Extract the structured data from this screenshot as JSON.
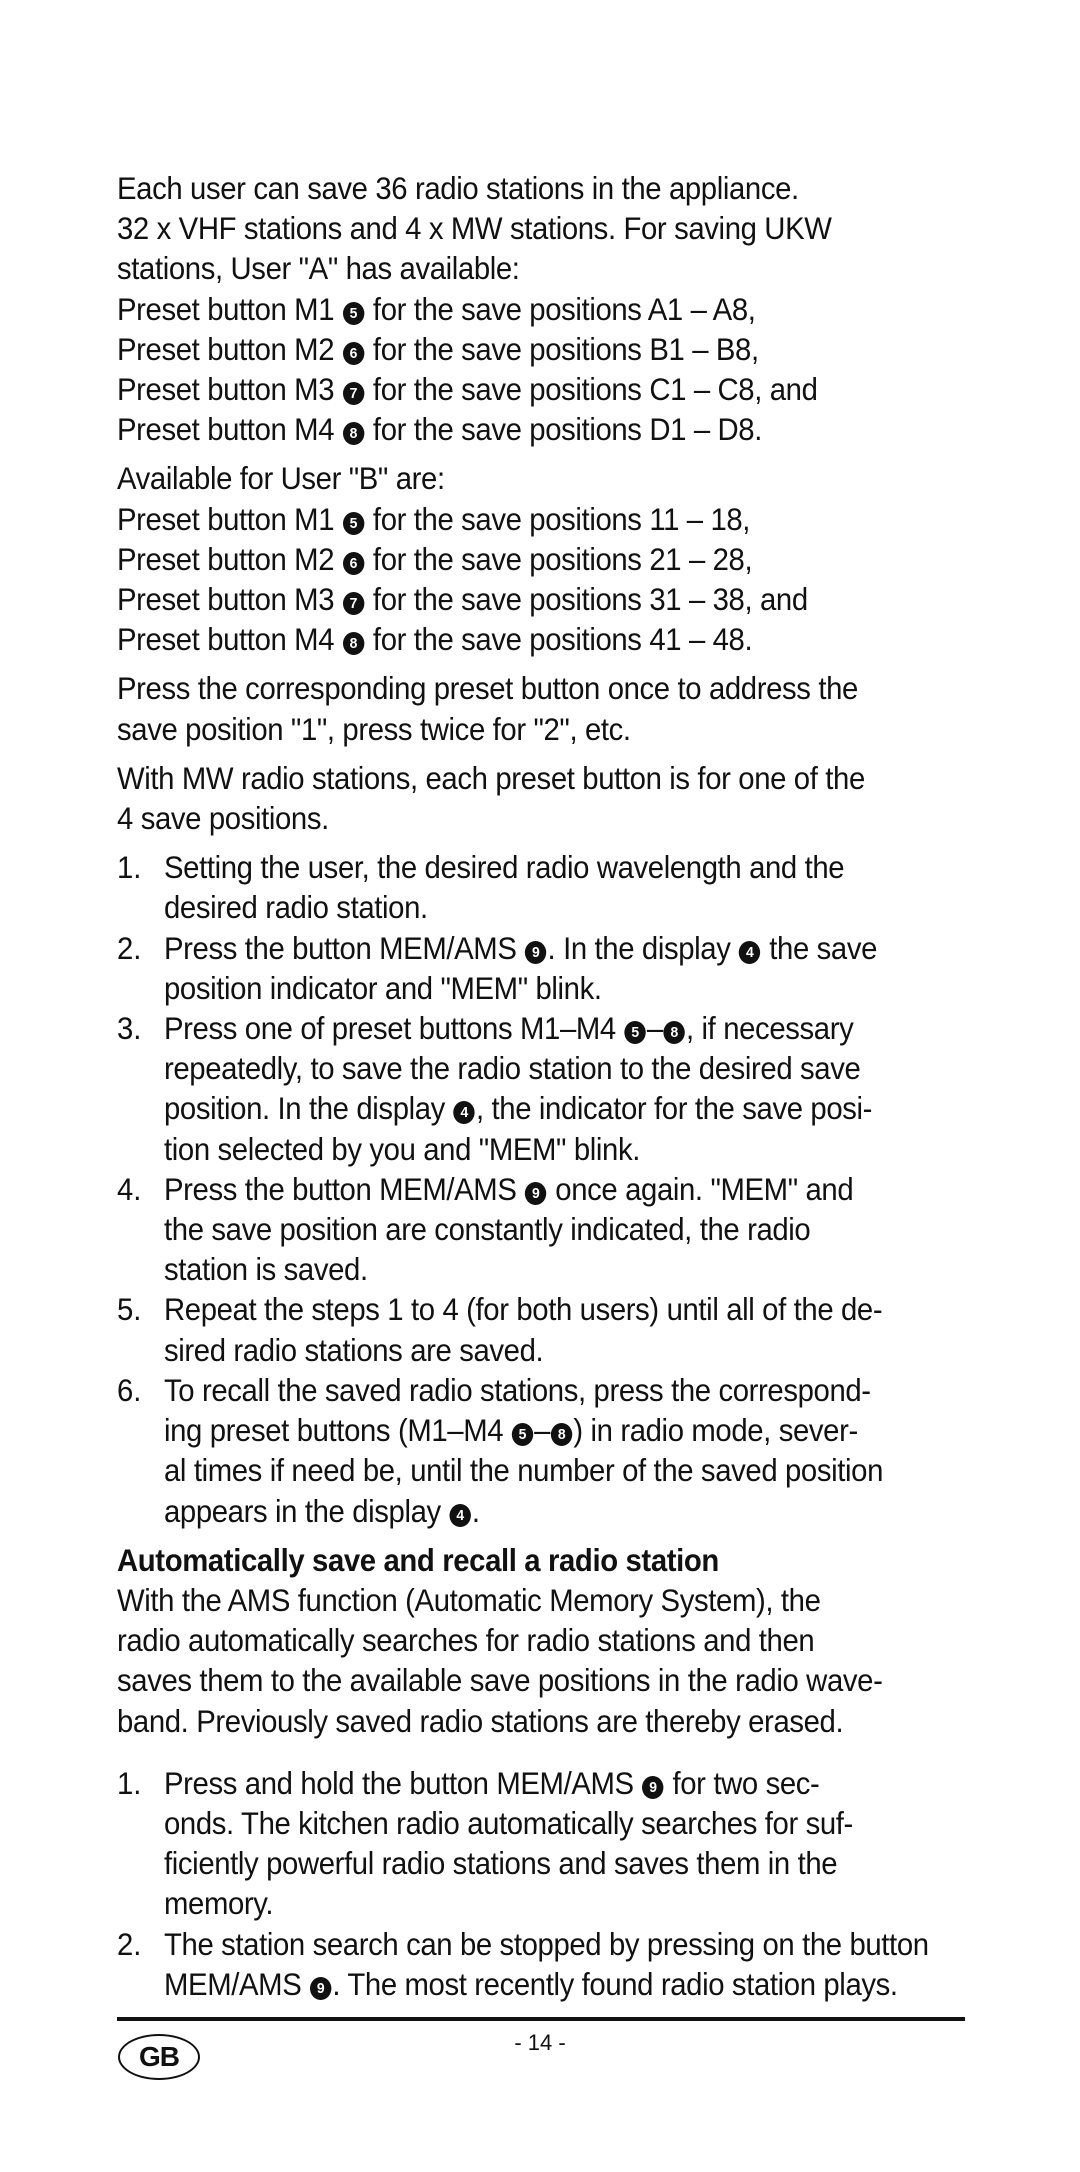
{
  "intro": [
    "Each user can save 36 radio stations in the appliance.",
    "32 x VHF stations and 4 x MW stations. For saving UKW",
    "stations, User \"A\" has available:"
  ],
  "user_a_presets": [
    {
      "pre": "Preset button M1",
      "ref": "5",
      "post": "for the save positions A1 – A8,"
    },
    {
      "pre": "Preset button M2",
      "ref": "6",
      "post": "for the save positions B1 – B8,"
    },
    {
      "pre": "Preset button M3",
      "ref": "7",
      "post": "for the save positions C1 – C8, and"
    },
    {
      "pre": "Preset button M4",
      "ref": "8",
      "post": "for the save positions D1 – D8."
    }
  ],
  "user_b_intro": "Available for User \"B\" are:",
  "user_b_presets": [
    {
      "pre": "Preset button M1",
      "ref": "5",
      "post": "for the save positions 11 – 18,"
    },
    {
      "pre": "Preset button M2",
      "ref": "6",
      "post": "for the save positions 21 – 28,"
    },
    {
      "pre": "Preset button M3",
      "ref": "7",
      "post": "for the save positions 31 – 38, and"
    },
    {
      "pre": "Preset button M4",
      "ref": "8",
      "post": "for the save positions 41 – 48."
    }
  ],
  "press_once": [
    "Press the corresponding preset button once to address the",
    "save position \"1\", press twice for \"2\", etc."
  ],
  "mw_note": [
    "With MW radio stations, each preset button is for one of the",
    "4 save positions."
  ],
  "manual_steps": [
    {
      "num": "1.",
      "lines": [
        [
          "Setting the user, the desired radio wavelength and the"
        ],
        [
          "desired radio station."
        ]
      ]
    },
    {
      "num": "2.",
      "lines": [
        [
          "Press the button MEM/AMS ",
          {
            "ref": "9"
          },
          ". In the display ",
          {
            "ref": "4"
          },
          " the save"
        ],
        [
          "position indicator and \"MEM\" blink."
        ]
      ]
    },
    {
      "num": "3.",
      "lines": [
        [
          "Press one of preset buttons M1–M4 ",
          {
            "ref": "5"
          },
          "–",
          {
            "ref": "8"
          },
          ", if necessary"
        ],
        [
          "repeatedly, to save the radio station to the desired save"
        ],
        [
          "position. In the display ",
          {
            "ref": "4"
          },
          ", the indicator for the save posi-"
        ],
        [
          "tion selected by you and \"MEM\" blink."
        ]
      ]
    },
    {
      "num": "4.",
      "lines": [
        [
          "Press the button MEM/AMS ",
          {
            "ref": "9"
          },
          " once again. \"MEM\" and"
        ],
        [
          "the save position are constantly indicated, the radio"
        ],
        [
          "station is saved."
        ]
      ]
    },
    {
      "num": "5.",
      "lines": [
        [
          "Repeat the steps 1 to 4 (for both users) until all of the de-"
        ],
        [
          "sired radio stations are saved."
        ]
      ]
    },
    {
      "num": "6.",
      "lines": [
        [
          "To recall the saved radio stations, press the correspond-"
        ],
        [
          "ing preset buttons (M1–M4 ",
          {
            "ref": "5"
          },
          "–",
          {
            "ref": "8"
          },
          ") in radio mode, sever-"
        ],
        [
          "al times if need be, until the number of the saved position"
        ],
        [
          "appears in the display ",
          {
            "ref": "4"
          },
          "."
        ]
      ]
    }
  ],
  "auto_heading": "Automatically save and recall a radio station",
  "auto_intro": [
    "With the AMS function (Automatic Memory System), the",
    "radio automatically searches for radio stations and then",
    "saves them to the available save positions in the radio wave-",
    "band. Previously saved radio stations are thereby erased."
  ],
  "auto_steps": [
    {
      "num": "1.",
      "lines": [
        [
          "Press and hold the button MEM/AMS ",
          {
            "ref": "9"
          },
          " for two sec-"
        ],
        [
          "onds. The kitchen radio automatically searches for suf-"
        ],
        [
          "ficiently powerful radio stations and saves them in the"
        ],
        [
          "memory."
        ]
      ]
    },
    {
      "num": "2.",
      "lines": [
        [
          "The station search can be stopped by pressing on the button"
        ],
        [
          "MEM/AMS ",
          {
            "ref": "9"
          },
          ". The most recently found radio station plays."
        ]
      ]
    }
  ],
  "footer": {
    "country_badge": "GB",
    "page_number": "- 14 -"
  }
}
